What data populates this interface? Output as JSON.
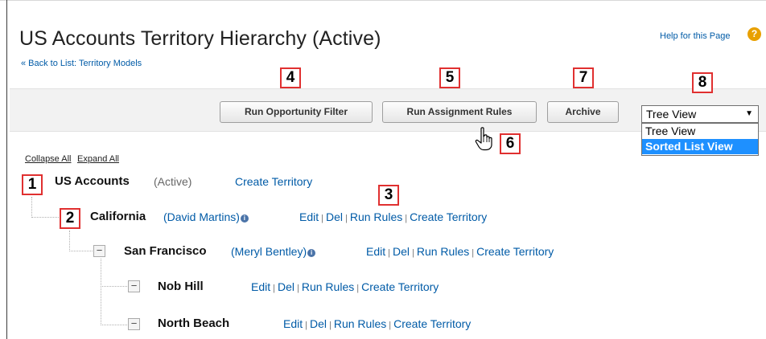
{
  "header": {
    "title": "US Accounts Territory Hierarchy (Active)",
    "back_link": "« Back to List: Territory Models",
    "help_link": "Help for this Page",
    "help_icon": "question-icon"
  },
  "toolbar": {
    "run_opportunity_filter": "Run Opportunity Filter",
    "run_assignment_rules": "Run Assignment Rules",
    "archive": "Archive",
    "view_select": {
      "value": "Tree View",
      "options": [
        "Tree View",
        "Sorted List View"
      ],
      "highlighted": "Sorted List View"
    }
  },
  "tree_controls": {
    "collapse_all": "Collapse All",
    "expand_all": "Expand All"
  },
  "tree": {
    "root": {
      "name": "US Accounts",
      "status": "(Active)",
      "create": "Create Territory"
    },
    "california": {
      "name": "California",
      "owner": "(David Martins)",
      "edit": "Edit",
      "del": "Del",
      "run_rules": "Run Rules",
      "create": "Create Territory"
    },
    "san_francisco": {
      "name": "San Francisco",
      "owner": "(Meryl Bentley)",
      "edit": "Edit",
      "del": "Del",
      "run_rules": "Run Rules",
      "create": "Create Territory"
    },
    "nob_hill": {
      "name": "Nob Hill",
      "edit": "Edit",
      "del": "Del",
      "run_rules": "Run Rules",
      "create": "Create Territory"
    },
    "north_beach": {
      "name": "North Beach",
      "edit": "Edit",
      "del": "Del",
      "run_rules": "Run Rules",
      "create": "Create Territory"
    },
    "separator": "|",
    "collapse_symbol": "−",
    "info_symbol": "i"
  },
  "callouts": [
    "1",
    "2",
    "3",
    "4",
    "5",
    "6",
    "7",
    "8"
  ],
  "colors": {
    "link": "#015ba7",
    "callout_border": "#e03030",
    "selected_option": "#1e90ff",
    "help_icon": "#e8a000"
  }
}
